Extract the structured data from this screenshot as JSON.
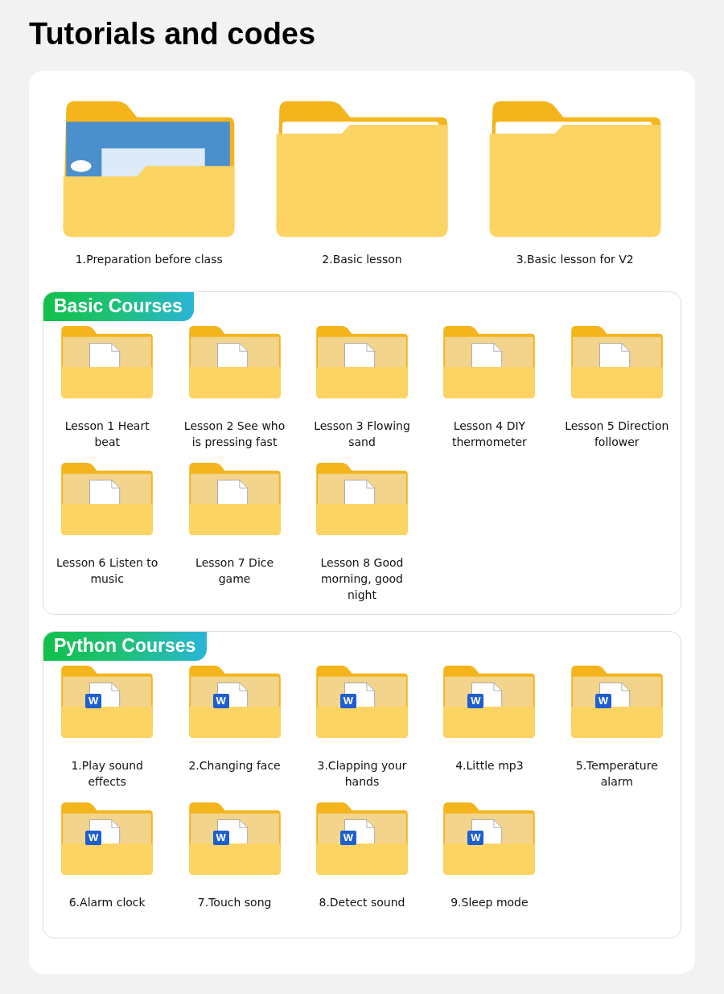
{
  "title": "Tutorials and codes",
  "top_folders": [
    {
      "label": "1.Preparation before class",
      "kind": "preview"
    },
    {
      "label": "2.Basic lesson",
      "kind": "empty"
    },
    {
      "label": "3.Basic lesson for V2",
      "kind": "empty"
    }
  ],
  "sections": [
    {
      "heading": "Basic Courses",
      "items": [
        {
          "label": "Lesson 1 Heart beat",
          "kind": "document"
        },
        {
          "label": "Lesson 2 See who is pressing fast",
          "kind": "document"
        },
        {
          "label": "Lesson 3 Flowing sand",
          "kind": "document"
        },
        {
          "label": "Lesson 4 DIY thermometer",
          "kind": "document"
        },
        {
          "label": "Lesson 5 Direction follower",
          "kind": "document"
        },
        {
          "label": "Lesson 6 Listen to music",
          "kind": "document"
        },
        {
          "label": "Lesson 7 Dice game",
          "kind": "document"
        },
        {
          "label": "Lesson 8 Good morning, good night",
          "kind": "document"
        }
      ]
    },
    {
      "heading": "Python Courses",
      "items": [
        {
          "label": "1.Play sound effects",
          "kind": "word",
          "badge": "W"
        },
        {
          "label": "2.Changing face",
          "kind": "word",
          "badge": "W"
        },
        {
          "label": "3.Clapping your hands",
          "kind": "word",
          "badge": "W"
        },
        {
          "label": "4.Little mp3",
          "kind": "word",
          "badge": "W"
        },
        {
          "label": "5.Temperature alarm",
          "kind": "word",
          "badge": "W"
        },
        {
          "label": "6.Alarm clock",
          "kind": "word",
          "badge": "W"
        },
        {
          "label": "7.Touch song",
          "kind": "word",
          "badge": "W"
        },
        {
          "label": "8.Detect sound",
          "kind": "word",
          "badge": "W"
        },
        {
          "label": "9.Sleep mode",
          "kind": "word",
          "badge": "W"
        }
      ]
    }
  ]
}
